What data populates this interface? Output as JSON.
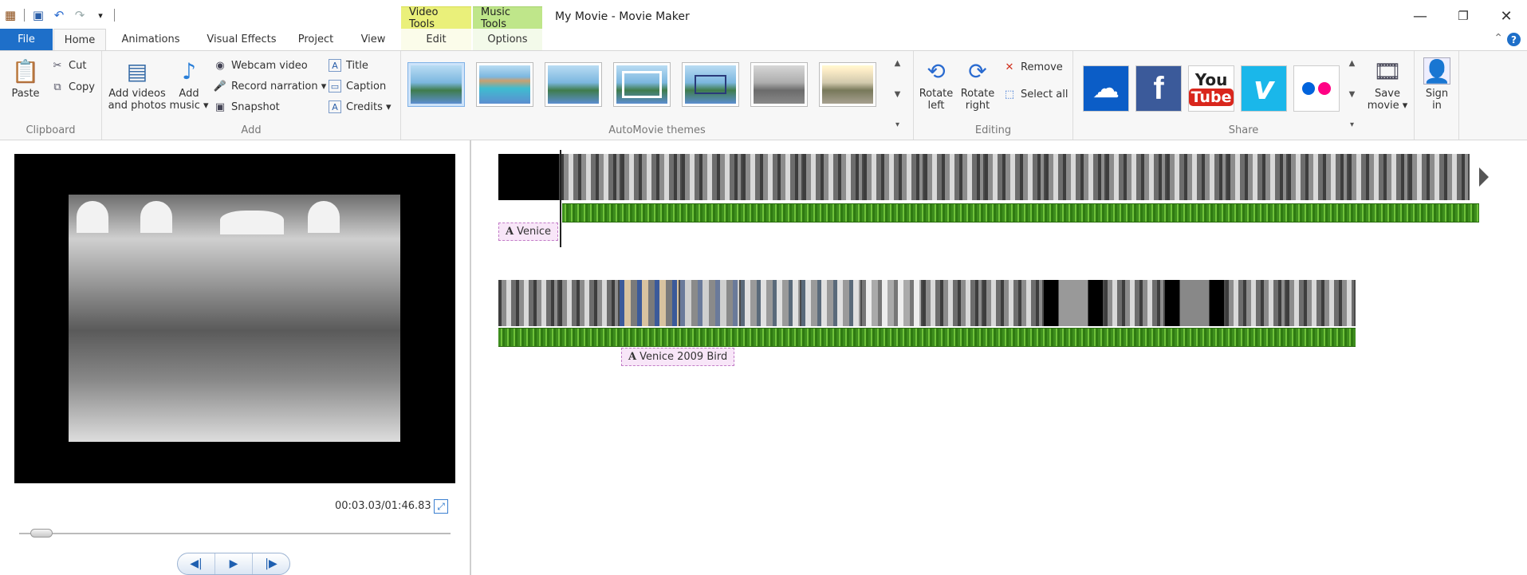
{
  "window": {
    "title": "My Movie - Movie Maker",
    "context_tabs": {
      "video_tools": "Video Tools",
      "music_tools": "Music Tools"
    },
    "controls": {
      "minimize": "—",
      "restore": "❐",
      "close": "✕"
    }
  },
  "tabs": {
    "file": "File",
    "home": "Home",
    "animations": "Animations",
    "visual_effects": "Visual Effects",
    "project": "Project",
    "view": "View",
    "edit": "Edit",
    "options": "Options",
    "help": "?"
  },
  "ribbon": {
    "clipboard": {
      "label": "Clipboard",
      "paste": "Paste",
      "cut": "Cut",
      "copy": "Copy"
    },
    "add": {
      "label": "Add",
      "add_videos_line1": "Add videos",
      "add_videos_line2": "and photos",
      "add_music_line1": "Add",
      "add_music_line2": "music ▾",
      "webcam_video": "Webcam video",
      "record_narration": "Record narration ▾",
      "snapshot": "Snapshot",
      "title": "Title",
      "caption": "Caption",
      "credits": "Credits ▾"
    },
    "themes": {
      "label": "AutoMovie themes",
      "count": 7
    },
    "editing": {
      "label": "Editing",
      "rotate_left_line1": "Rotate",
      "rotate_left_line2": "left",
      "rotate_right_line1": "Rotate",
      "rotate_right_line2": "right",
      "remove": "Remove",
      "select_all": "Select all"
    },
    "share": {
      "label": "Share",
      "save_movie_line1": "Save",
      "save_movie_line2": "movie ▾",
      "sign_in_line1": "Sign",
      "sign_in_line2": "in",
      "youtube_line1": "You",
      "youtube_line2": "Tube",
      "facebook": "f",
      "vimeo": "v"
    }
  },
  "preview": {
    "timecode": "00:03.03/01:46.83",
    "seek_position": 0.028,
    "controls": {
      "previous": "◀|",
      "play": "▶",
      "next": "|▶"
    }
  },
  "storyboard": {
    "captions": {
      "venice": "Venice",
      "venice_bird": "Venice 2009 Bird"
    }
  },
  "colors": {
    "file_tab": "#1e6fc9",
    "video_tools": "#eaf07a",
    "music_tools": "#bfe68a",
    "audio_wave": "#4da32a",
    "caption_bg": "#f8e6f8"
  }
}
